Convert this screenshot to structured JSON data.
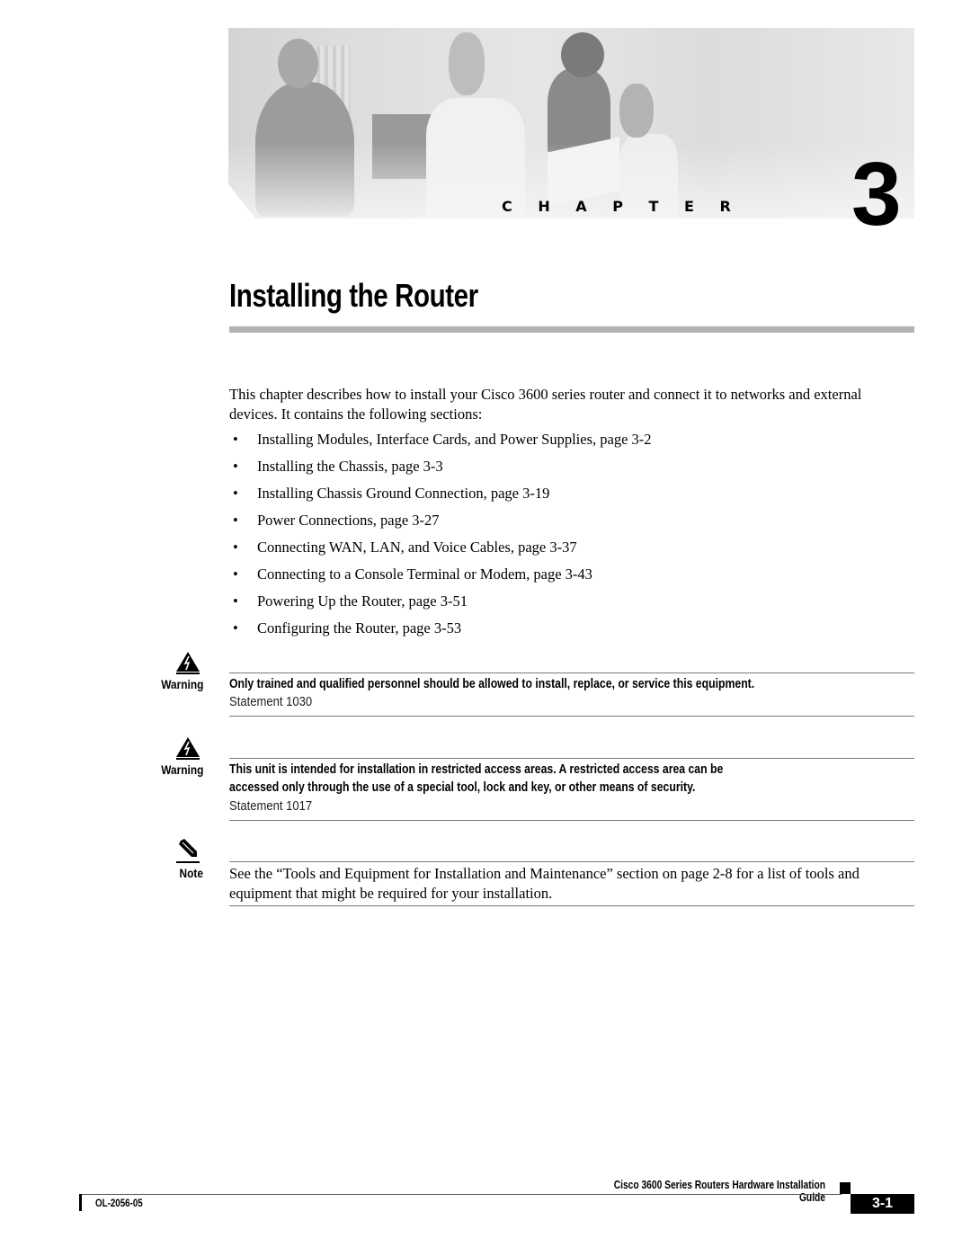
{
  "banner": {
    "photo_description": "Four people working with laptop, router rack and documents (grayscale)",
    "chapter_label": "C H A P T E R",
    "chapter_number": "3"
  },
  "title": "Installing the Router",
  "intro": "This chapter describes how to install your Cisco 3600 series router and connect it to networks and external devices. It contains the following sections:",
  "bullet_glyph": "•",
  "sections": [
    {
      "label": "Installing Modules, Interface Cards, and Power Supplies, page 3-2"
    },
    {
      "label": "Installing the Chassis, page 3-3"
    },
    {
      "label": "Installing Chassis Ground Connection, page 3-19"
    },
    {
      "label": "Power Connections, page 3-27"
    },
    {
      "label": "Connecting WAN, LAN, and Voice Cables, page 3-37"
    },
    {
      "label": "Connecting to a Console Terminal or Modem, page 3-43"
    },
    {
      "label": "Powering Up the Router, page 3-51"
    },
    {
      "label": "Configuring the Router, page 3-53"
    }
  ],
  "admonitions": [
    {
      "type": "Warning",
      "icon": "warning-triangle-lightning-icon",
      "text": "Only trained and qualified personnel should be allowed to install, replace, or service this equipment.",
      "statement": "Statement 1030"
    },
    {
      "type": "Warning",
      "icon": "warning-triangle-lightning-icon",
      "text_line1": "This unit is intended for installation in restricted access areas. A restricted access area can be",
      "text_line2": "accessed only through the use of a special tool, lock and key, or other means of security.",
      "statement": "Statement 1017"
    },
    {
      "type": "Note",
      "icon": "pencil-note-icon",
      "text": "See the “Tools and Equipment for Installation and Maintenance” section on page 2-8 for a list of tools and equipment that might be required for your installation."
    }
  ],
  "footer": {
    "guide_title": "Cisco 3600 Series Routers Hardware Installation Guide",
    "doc_number": "OL-2056-05",
    "page_number": "3-1"
  }
}
